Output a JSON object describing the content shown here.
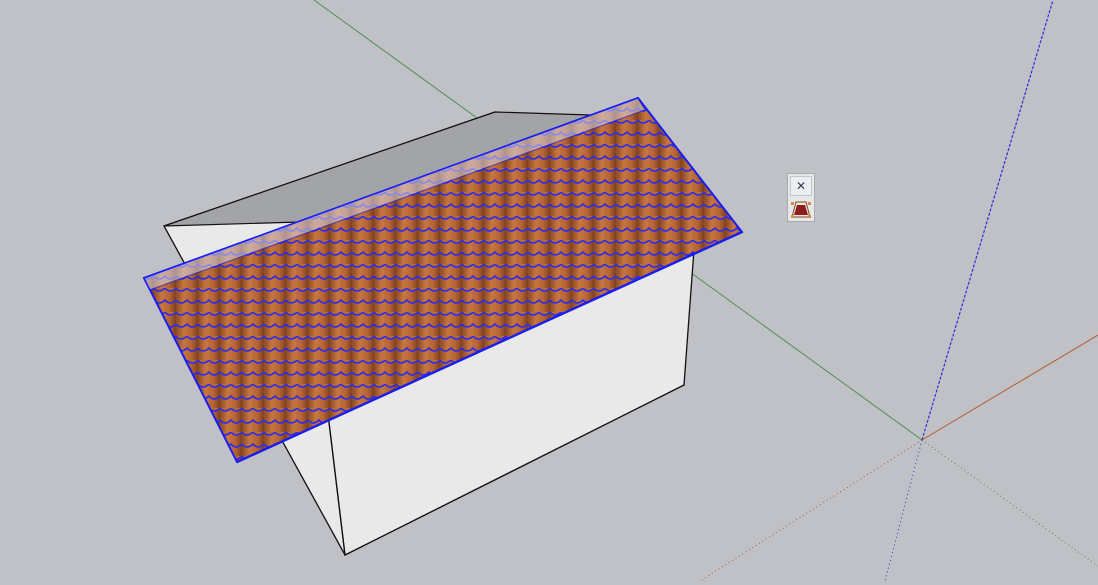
{
  "scene": {
    "background_color": "#c0c1c6",
    "axes": {
      "green_axis_color": "#4d8f53",
      "red_axis_color": "#b25a2a",
      "blue_axis_color": "#2d2fd6"
    },
    "model": {
      "wall_color": "#e9e9ea",
      "wall_shade_color": "#a3a4a7",
      "roof_tile_color": "#b86938",
      "selection_color": "#1a1ef0"
    }
  },
  "floating_toolbar": {
    "close_glyph": "✕",
    "tool_icon": "roof-tile-tool-icon"
  }
}
